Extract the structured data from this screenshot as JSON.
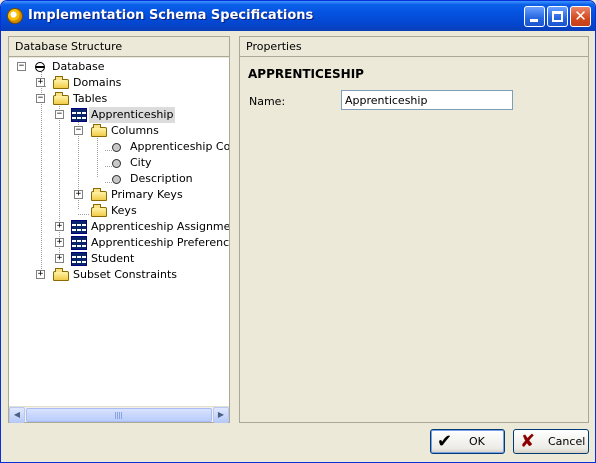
{
  "window": {
    "title": "Implementation Schema Specifications"
  },
  "left_panel": {
    "header": "Database Structure",
    "tree": [
      {
        "label": "Database",
        "icon": "database-icon",
        "expander": "−"
      },
      {
        "label": "Domains",
        "icon": "folder-icon",
        "expander": "+"
      },
      {
        "label": "Tables",
        "icon": "folder-open-icon",
        "expander": "−"
      },
      {
        "label": "Apprenticeship",
        "icon": "table-icon",
        "expander": "−",
        "selected": true
      },
      {
        "label": "Columns",
        "icon": "folder-open-icon",
        "expander": "−"
      },
      {
        "label": "Apprenticeship Code",
        "icon": "column-icon"
      },
      {
        "label": "City",
        "icon": "column-icon"
      },
      {
        "label": "Description",
        "icon": "column-icon"
      },
      {
        "label": "Primary Keys",
        "icon": "folder-icon",
        "expander": "+"
      },
      {
        "label": "Keys",
        "icon": "folder-icon"
      },
      {
        "label": "Apprenticeship Assignment",
        "icon": "table-icon",
        "expander": "+"
      },
      {
        "label": "Apprenticeship Preference",
        "icon": "table-icon",
        "expander": "+"
      },
      {
        "label": "Student",
        "icon": "table-icon",
        "expander": "+"
      },
      {
        "label": "Subset Constraints",
        "icon": "folder-icon",
        "expander": "+"
      }
    ]
  },
  "right_panel": {
    "header": "Properties",
    "entity_title": "APPRENTICESHIP",
    "name_label": "Name:",
    "name_value": "Apprenticeship"
  },
  "buttons": {
    "ok": "OK",
    "cancel": "Cancel"
  }
}
